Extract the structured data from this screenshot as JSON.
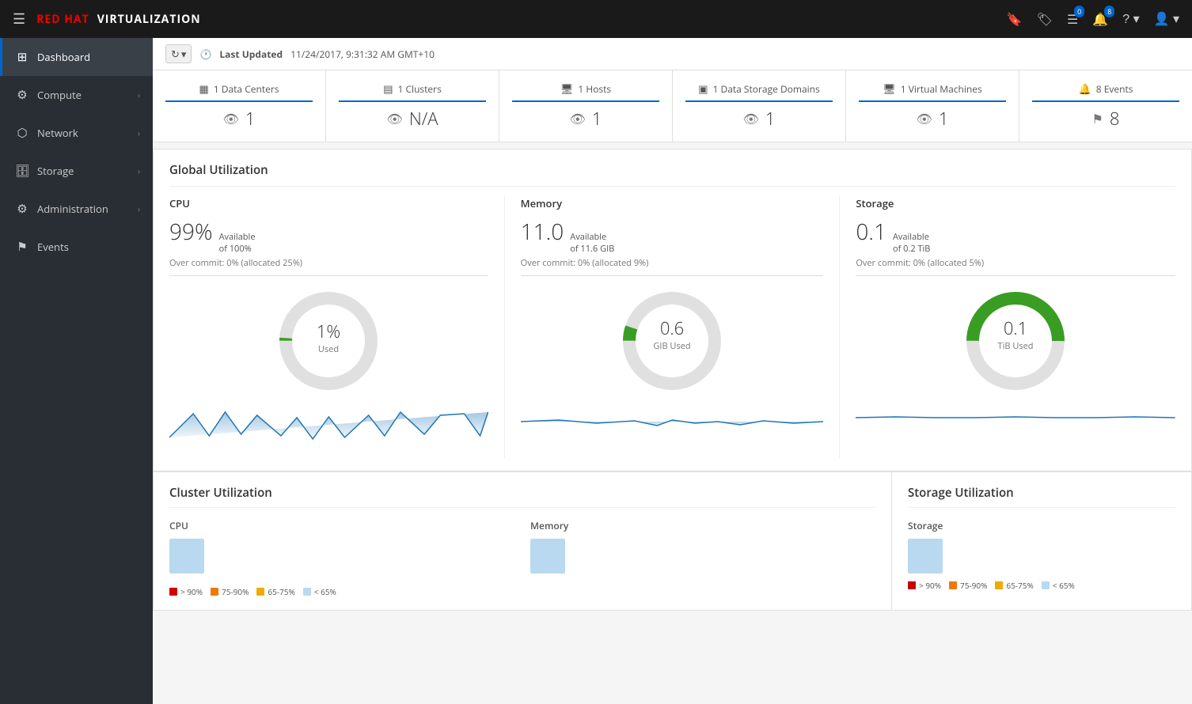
{
  "app": {
    "name": "RED HAT VIRTUALIZATION",
    "red": "RED HAT",
    "virt": "VIRTUALIZATION"
  },
  "navbar": {
    "bookmark_badge": "",
    "tag_badge": "",
    "list_badge": "0",
    "bell_badge": "8",
    "help_label": "?",
    "user_label": "👤"
  },
  "sidebar": {
    "items": [
      {
        "id": "dashboard",
        "label": "Dashboard",
        "icon": "⊞",
        "active": true,
        "chevron": false
      },
      {
        "id": "compute",
        "label": "Compute",
        "icon": "⚙",
        "active": false,
        "chevron": true
      },
      {
        "id": "network",
        "label": "Network",
        "icon": "⬡",
        "active": false,
        "chevron": true
      },
      {
        "id": "storage",
        "label": "Storage",
        "icon": "🗄",
        "active": false,
        "chevron": true
      },
      {
        "id": "administration",
        "label": "Administration",
        "icon": "⚙",
        "active": false,
        "chevron": true
      },
      {
        "id": "events",
        "label": "Events",
        "icon": "⚑",
        "active": false,
        "chevron": false
      }
    ]
  },
  "topbar": {
    "last_updated_label": "Last Updated",
    "timestamp": "11/24/2017, 9:31:32 AM GMT+10"
  },
  "summary_cards": [
    {
      "id": "data-centers",
      "icon": "▦",
      "label": "1 Data Centers",
      "count": "1",
      "count_icon": "eye"
    },
    {
      "id": "clusters",
      "icon": "▤",
      "label": "1 Clusters",
      "count": "N/A",
      "count_icon": "eye"
    },
    {
      "id": "hosts",
      "icon": "🖥",
      "label": "1 Hosts",
      "count": "1",
      "count_icon": "eye"
    },
    {
      "id": "data-storage",
      "icon": "▣",
      "label": "1 Data Storage Domains",
      "count": "1",
      "count_icon": "eye"
    },
    {
      "id": "vms",
      "icon": "🖥",
      "label": "1 Virtual Machines",
      "count": "1",
      "count_icon": "eye"
    },
    {
      "id": "events",
      "icon": "🔔",
      "label": "8 Events",
      "count": "8",
      "count_icon": "flag"
    }
  ],
  "global_utilization": {
    "title": "Global Utilization",
    "cpu": {
      "label": "CPU",
      "percent": "99%",
      "available": "Available",
      "of": "of 100%",
      "overcommit": "Over commit: 0% (allocated 25%)",
      "donut_value": 1,
      "donut_label": "1%",
      "donut_sub": "Used"
    },
    "memory": {
      "label": "Memory",
      "percent": "11.0",
      "available": "Available",
      "of": "of 11.6 GIB",
      "overcommit": "Over commit: 0% (allocated 9%)",
      "donut_value": 5,
      "donut_label": "0.6",
      "donut_sub": "GIB Used"
    },
    "storage": {
      "label": "Storage",
      "percent": "0.1",
      "available": "Available",
      "of": "of 0.2 TiB",
      "overcommit": "Over commit: 0% (allocated 5%)",
      "donut_value": 50,
      "donut_label": "0.1",
      "donut_sub": "TiB Used"
    }
  },
  "cluster_utilization": {
    "title": "Cluster Utilization",
    "cpu_label": "CPU",
    "memory_label": "Memory",
    "legend": [
      {
        "color": "#cc0000",
        "label": "> 90%"
      },
      {
        "color": "#ec7a08",
        "label": "75-90%"
      },
      {
        "color": "#f0ab00",
        "label": "65-75%"
      },
      {
        "color": "#b8d9f0",
        "label": "< 65%"
      }
    ]
  },
  "storage_utilization": {
    "title": "Storage Utilization",
    "storage_label": "Storage",
    "legend": [
      {
        "color": "#cc0000",
        "label": "> 90%"
      },
      {
        "color": "#ec7a08",
        "label": "75-90%"
      },
      {
        "color": "#f0ab00",
        "label": "65-75%"
      },
      {
        "color": "#b8d9f0",
        "label": "< 65%"
      }
    ]
  }
}
